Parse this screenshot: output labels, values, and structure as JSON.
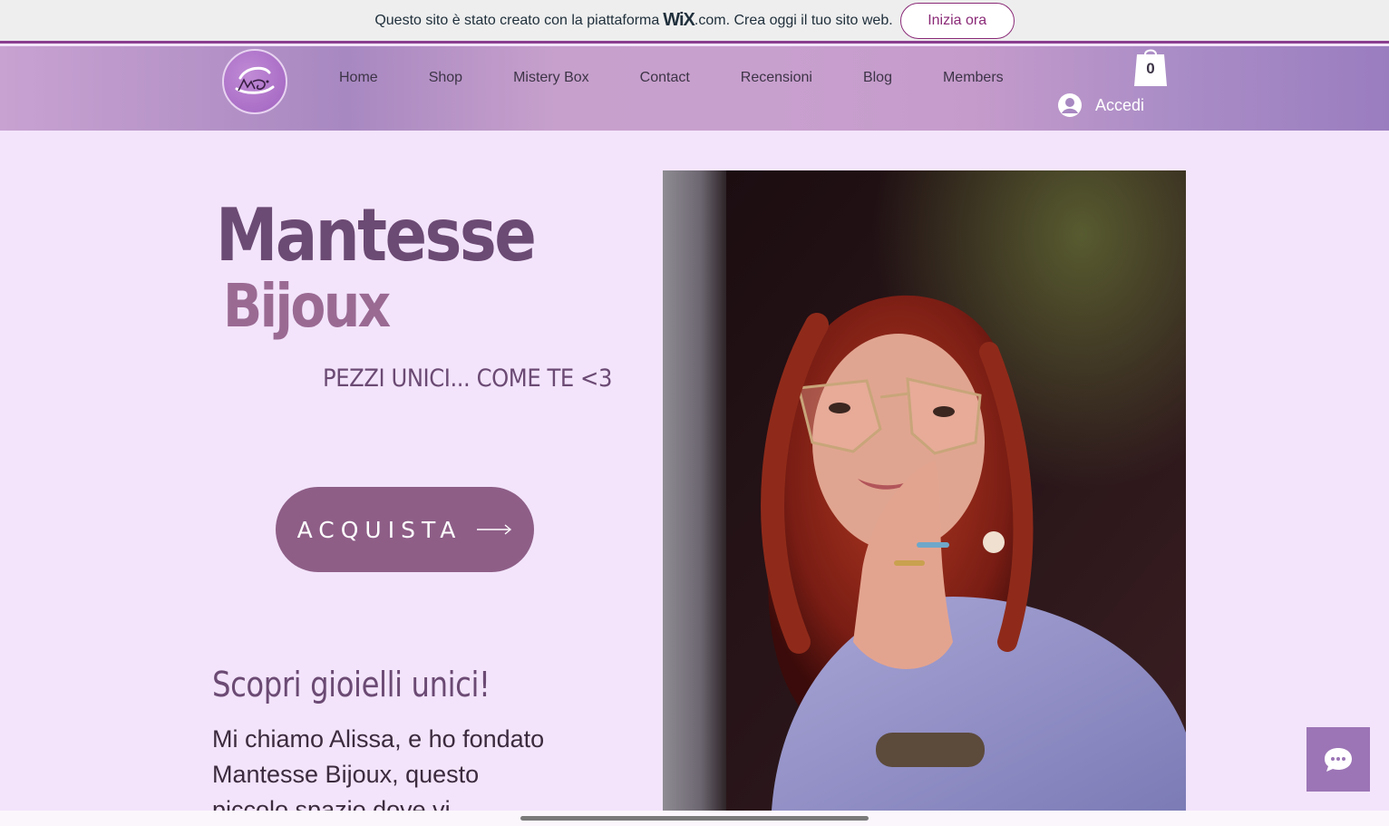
{
  "wix_banner": {
    "text_before": "Questo sito è stato creato con la piattaforma",
    "wix_logo": "WiX",
    "text_after": ".com. Crea oggi il tuo sito web.",
    "cta_label": "Inizia ora"
  },
  "header": {
    "logo_icon": "mantesse-logo-icon",
    "nav": [
      {
        "label": "Home"
      },
      {
        "label": "Shop"
      },
      {
        "label": "Mistery Box"
      },
      {
        "label": "Contact"
      },
      {
        "label": "Recensioni"
      },
      {
        "label": "Blog"
      },
      {
        "label": "Members"
      }
    ],
    "cart_count": "0",
    "login_label": "Accedi"
  },
  "hero": {
    "title_line1": "Mantesse",
    "title_line2": "Bijoux",
    "tagline": "PEZZI UNICI... COME TE <3",
    "buy_label": "ACQUISTA",
    "section_heading": "Scopri gioielli unici!",
    "intro": "Mi chiamo Alissa, e ho fondato Mantesse Bijoux, questo piccolo spazio dove vi"
  },
  "colors": {
    "accent": "#8e5e87",
    "title": "#6b4a73",
    "background": "#f3e4fb",
    "chat": "#9c75b6"
  }
}
